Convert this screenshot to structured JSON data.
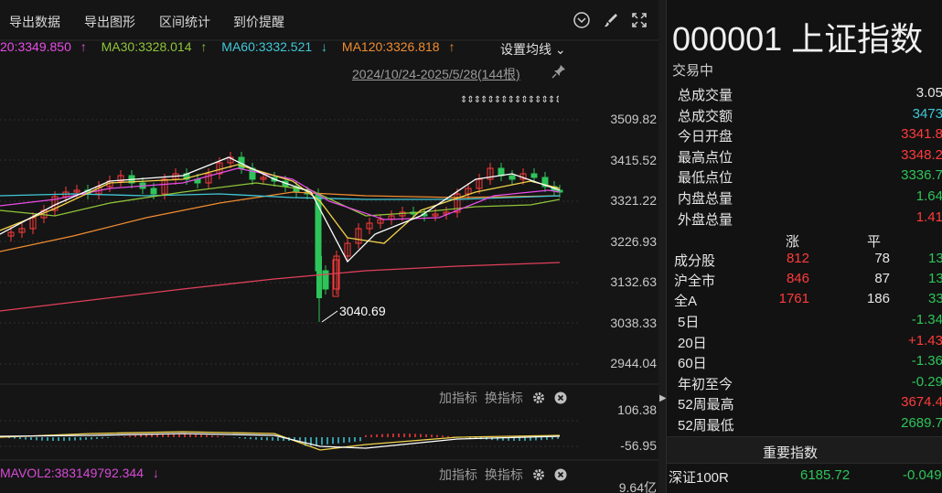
{
  "toolbar": {
    "export_data": "导出数据",
    "export_chart": "导出图形",
    "range_stats": "区间统计",
    "price_alert": "到价提醒"
  },
  "ma_bar": {
    "ma20": "20:3349.850",
    "ma20_arrow": "↑",
    "ma30": "MA30:3328.014",
    "ma30_arrow": "↑",
    "ma60": "MA60:3332.521",
    "ma60_arrow": "↓",
    "ma120": "MA120:3326.818",
    "ma120_arrow": "↑",
    "settings": "设置均线"
  },
  "date_range": "2024/10/24-2025/5/28(144根)",
  "signal_arrows": "⇕⇕⇕⇕⇕⇕⇕⇕⇕⇕⇕⇕⇕⇕⇕⇕",
  "price_axis": [
    "3509.82",
    "3415.52",
    "3321.22",
    "3226.93",
    "3132.63",
    "3038.33",
    "2944.04"
  ],
  "low_annotation": "3040.69",
  "macd_panel": {
    "add_indicator": "加指标",
    "switch_indicator": "换指标",
    "axis_top": "106.38",
    "axis_bottom": "-56.95"
  },
  "vol_panel": {
    "label": "MAVOL2:383149792.344",
    "label_arrow": "↓",
    "add_indicator": "加指标",
    "switch_indicator": "换指标",
    "axis_top": "9.64亿"
  },
  "colors": {
    "up": "#ff3b3b",
    "down": "#2ec45a",
    "ma5": "#ffffff",
    "ma10": "#f2d24a",
    "ma20": "#e84ce8",
    "ma30": "#8fc43a",
    "ma60": "#40c8d8",
    "ma120": "#f08c30",
    "ma250": "#e0405a"
  },
  "panel": {
    "title": "000001 上证指数",
    "status": "交易中",
    "stats": [
      {
        "label": "总成交量",
        "value": "3.05",
        "cls": "flat"
      },
      {
        "label": "总成交额",
        "value": "3473",
        "cls": "cyan"
      },
      {
        "label": "今日开盘",
        "value": "3341.8",
        "cls": "up"
      },
      {
        "label": "最高点位",
        "value": "3348.2",
        "cls": "up"
      },
      {
        "label": "最低点位",
        "value": "3336.7",
        "cls": "down"
      },
      {
        "label": "内盘总量",
        "value": "1.64",
        "cls": "down"
      },
      {
        "label": "外盘总量",
        "value": "1.41",
        "cls": "up"
      }
    ],
    "breadth_headers": {
      "up": "涨",
      "flat": "平"
    },
    "breadth": [
      {
        "label": "成分股",
        "up": "812",
        "flat": "78",
        "down": "13"
      },
      {
        "label": "沪全市",
        "up": "846",
        "flat": "87",
        "down": "13"
      },
      {
        "label": "全A",
        "up": "1761",
        "flat": "186",
        "down": "33"
      }
    ],
    "periods": [
      {
        "label": "5日",
        "value": "-1.34",
        "cls": "down"
      },
      {
        "label": "20日",
        "value": "+1.43",
        "cls": "up"
      },
      {
        "label": "60日",
        "value": "-1.36",
        "cls": "down"
      },
      {
        "label": "年初至今",
        "value": "-0.29",
        "cls": "down"
      },
      {
        "label": "52周最高",
        "value": "3674.4",
        "cls": "up"
      },
      {
        "label": "52周最低",
        "value": "2689.7",
        "cls": "down"
      }
    ],
    "important_title": "重要指数",
    "important": [
      {
        "name": "深证100R",
        "price": "6185.72",
        "change": "-0.049"
      }
    ]
  }
}
